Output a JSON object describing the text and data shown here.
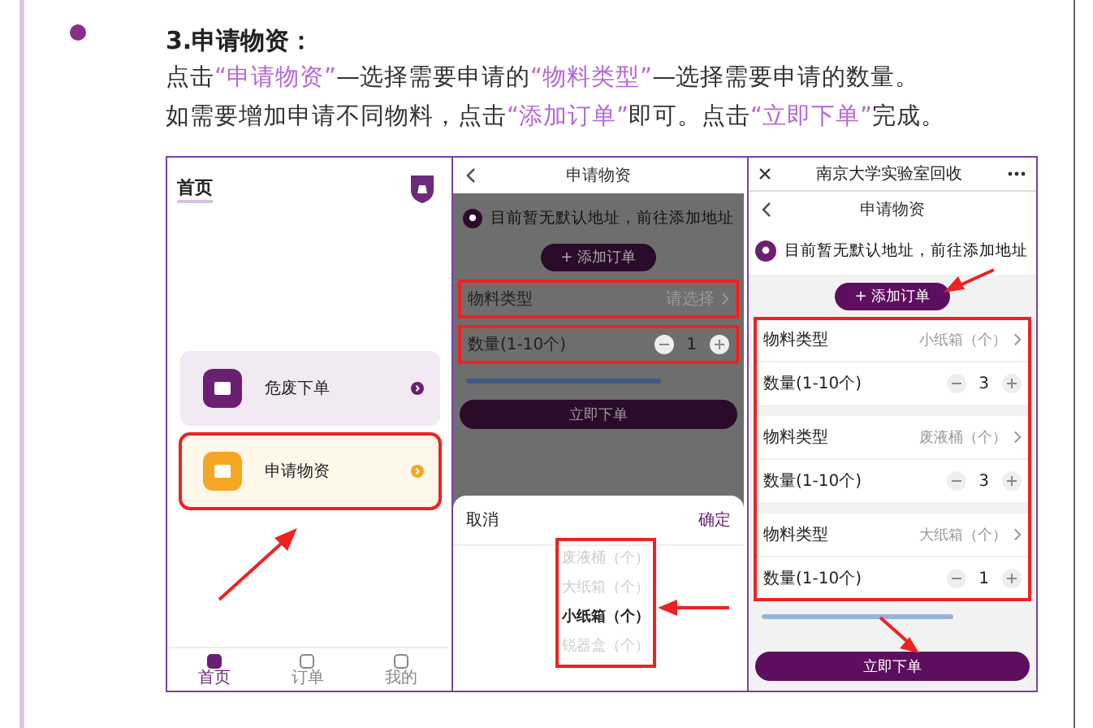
{
  "section_title": "3.申请物资：",
  "paragraph_lines": [
    [
      {
        "text": "点击",
        "highlight": false
      },
      {
        "text": "“申请物资”",
        "highlight": true
      },
      {
        "text": "—选择需要申请的",
        "highlight": false
      },
      {
        "text": "“物料类型”",
        "highlight": true
      },
      {
        "text": "—选择需要申请的数量。",
        "highlight": false
      }
    ],
    [
      {
        "text": "如需要增加申请不同物料，点击",
        "highlight": false
      },
      {
        "text": "“添加订单”",
        "highlight": true
      },
      {
        "text": "即可。点击",
        "highlight": false
      },
      {
        "text": "“立即下单”",
        "highlight": true
      },
      {
        "text": "完成。",
        "highlight": false
      }
    ]
  ],
  "screenshots": [
    {
      "kind": "home",
      "title": "首页",
      "cards": [
        {
          "label": "危废下单",
          "color": "#6b1f73",
          "highlighted": false
        },
        {
          "label": "申请物资",
          "color": "#f5a623",
          "highlighted": true
        }
      ],
      "tabs": [
        {
          "label": "首页",
          "selected": true
        },
        {
          "label": "订单",
          "selected": false
        },
        {
          "label": "我的",
          "selected": false
        }
      ]
    },
    {
      "kind": "picker",
      "nav_title": "申请物资",
      "address": "目前暂无默认地址，前往添加地址",
      "add_button": "+ 添加订单",
      "type_row": {
        "label": "物料类型",
        "value": "请选择",
        "highlighted": true
      },
      "quantity_row": {
        "label": "数量(1-10个)",
        "value": "1",
        "highlighted": true
      },
      "submit": "立即下单",
      "sheet": {
        "cancel": "取消",
        "confirm": "确定",
        "options_highlighted": true,
        "options": [
          {
            "label": "废液桶（个）",
            "selected": false
          },
          {
            "label": "大纸箱（个）",
            "selected": false
          },
          {
            "label": "小纸箱（个）",
            "selected": true
          },
          {
            "label": "锐器盒（个）",
            "selected": false
          }
        ]
      }
    },
    {
      "kind": "form",
      "app_title": "南京大学实验室回收",
      "nav_title": "申请物资",
      "address": "目前暂无默认地址，前往添加地址",
      "add_button": "+ 添加订单",
      "items_highlighted": true,
      "items": [
        {
          "type_label": "物料类型",
          "type_value": "小纸箱（个）",
          "qty_label": "数量(1-10个)",
          "qty": "3"
        },
        {
          "type_label": "物料类型",
          "type_value": "废液桶（个）",
          "qty_label": "数量(1-10个)",
          "qty": "3"
        },
        {
          "type_label": "物料类型",
          "type_value": "大纸箱（个）",
          "qty_label": "数量(1-10个)",
          "qty": "1"
        }
      ],
      "submit": "立即下单"
    }
  ]
}
